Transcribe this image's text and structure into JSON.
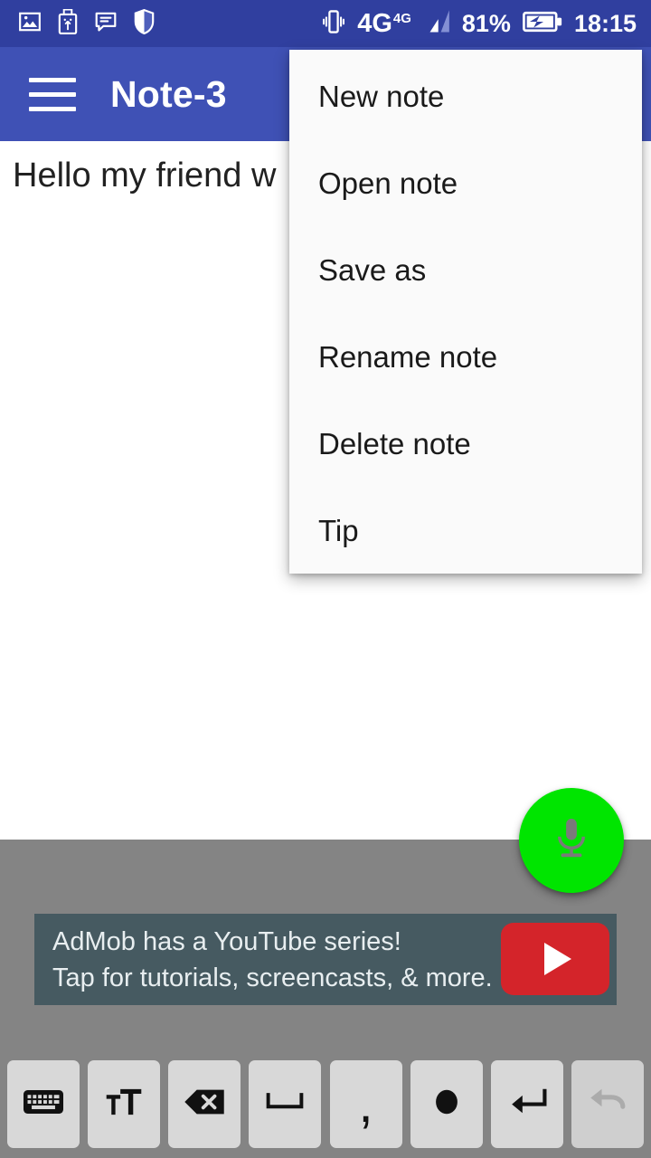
{
  "status_bar": {
    "background": "#303F9F",
    "left_icons": [
      {
        "name": "image-icon",
        "label": "image"
      },
      {
        "name": "usb-icon",
        "label": "usb"
      },
      {
        "name": "message-icon",
        "label": "message"
      },
      {
        "name": "shield-icon",
        "label": "shield"
      }
    ],
    "vibrate_icon": "vibrate",
    "network_type": "4G",
    "network_type_sup": "4G",
    "signal_bars": 2,
    "battery_percent": "81%",
    "battery_icon": "battery-charging-icon",
    "clock": "18:15"
  },
  "app_bar": {
    "background": "#3F51B5",
    "menu_icon": "hamburger-menu-icon",
    "title": "Note-3"
  },
  "note": {
    "text": "Hello my friend w"
  },
  "overflow_menu": {
    "background": "#FAFAFA",
    "items": [
      {
        "label": "New note"
      },
      {
        "label": "Open note"
      },
      {
        "label": "Save as"
      },
      {
        "label": "Rename note"
      },
      {
        "label": "Delete note"
      },
      {
        "label": "Tip"
      }
    ]
  },
  "fab": {
    "name": "microphone-fab",
    "color": "#00E500",
    "icon": "microphone-icon"
  },
  "ad": {
    "background": "#465A61",
    "line1": "AdMob has a YouTube series!",
    "line2": "Tap for tutorials, screencasts, & more.",
    "button_icon": "youtube-play-icon",
    "button_color": "#D4242A"
  },
  "key_bar": {
    "background": "#848484",
    "keys": [
      {
        "name": "keyboard-key",
        "icon": "keyboard-icon",
        "glyph": "",
        "disabled": false
      },
      {
        "name": "text-size-key",
        "icon": "text-size-icon",
        "glyph": "",
        "disabled": false
      },
      {
        "name": "backspace-key",
        "icon": "backspace-icon",
        "glyph": "",
        "disabled": false
      },
      {
        "name": "space-key",
        "icon": "space-bar-icon",
        "glyph": "",
        "disabled": false
      },
      {
        "name": "comma-key",
        "icon": "comma-icon",
        "glyph": ",",
        "disabled": false
      },
      {
        "name": "period-key",
        "icon": "period-dot-icon",
        "glyph": "",
        "disabled": false
      },
      {
        "name": "enter-key",
        "icon": "enter-return-icon",
        "glyph": "",
        "disabled": false
      },
      {
        "name": "undo-key",
        "icon": "undo-icon",
        "glyph": "",
        "disabled": true
      }
    ]
  }
}
